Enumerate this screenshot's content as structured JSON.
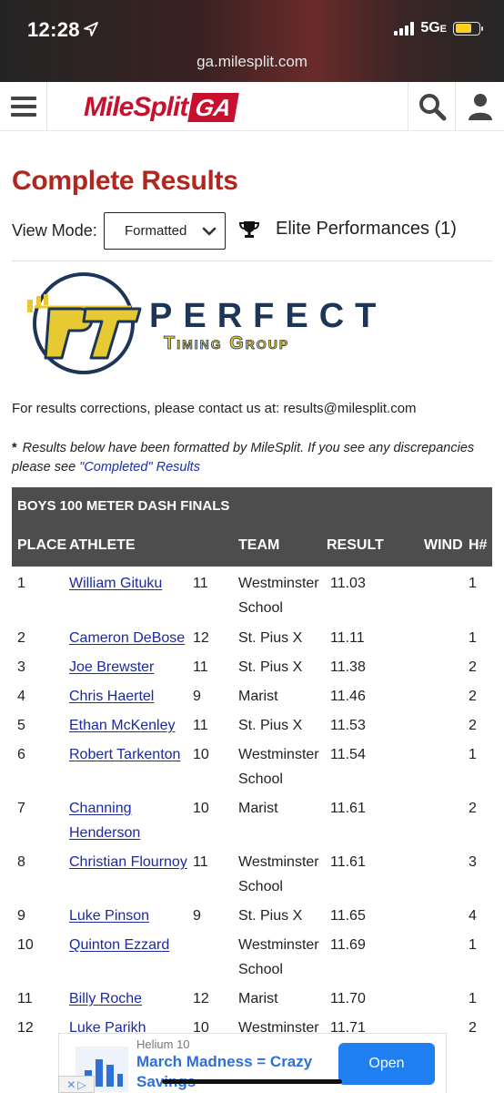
{
  "status_bar": {
    "time": "12:28",
    "network": "5G",
    "network_sup": "E"
  },
  "browser": {
    "url": "ga.milesplit.com"
  },
  "site": {
    "logo_text": "MileSplit",
    "logo_region": "GA"
  },
  "page": {
    "title": "Complete Results",
    "view_mode_label": "View Mode:",
    "view_mode_value": "Formatted",
    "elite_performances": "Elite Performances (1)"
  },
  "timer_logo": {
    "mark": "PT",
    "line1": "PERFECT",
    "line2": "Timing Group"
  },
  "contact_text": "For results corrections, please contact us at: results@milesplit.com",
  "note": {
    "star": "*",
    "text": "Results below have been formatted by MileSplit. If you see any discrepancies please see",
    "link": "\"Completed\" Results"
  },
  "results": {
    "event_title": "BOYS 100 METER DASH FINALS",
    "headers": {
      "place": "PLACE",
      "athlete": "ATHLETE",
      "team": "TEAM",
      "result": "RESULT",
      "wind": "WIND",
      "heat": "H#"
    },
    "rows": [
      {
        "place": "1",
        "athlete": "William Gituku",
        "grade": "11",
        "team": "Westminster School",
        "result": "11.03",
        "heat": "1"
      },
      {
        "place": "2",
        "athlete": "Cameron DeBose",
        "grade": "12",
        "team": "St. Pius X",
        "result": "11.11",
        "heat": "1"
      },
      {
        "place": "3",
        "athlete": "Joe Brewster",
        "grade": "11",
        "team": "St. Pius X",
        "result": "11.38",
        "heat": "2"
      },
      {
        "place": "4",
        "athlete": "Chris Haertel",
        "grade": "9",
        "team": "Marist",
        "result": "11.46",
        "heat": "2"
      },
      {
        "place": "5",
        "athlete": "Ethan McKenley",
        "grade": "11",
        "team": "St. Pius X",
        "result": "11.53",
        "heat": "2"
      },
      {
        "place": "6",
        "athlete": "Robert Tarkenton",
        "grade": "10",
        "team": "Westminster School",
        "result": "11.54",
        "heat": "1"
      },
      {
        "place": "7",
        "athlete": "Channing Henderson",
        "grade": "10",
        "team": "Marist",
        "result": "11.61",
        "heat": "2"
      },
      {
        "place": "8",
        "athlete": "Christian Flournoy",
        "grade": "11",
        "team": "Westminster School",
        "result": "11.61",
        "heat": "3"
      },
      {
        "place": "9",
        "athlete": "Luke Pinson",
        "grade": "9",
        "team": "St. Pius X",
        "result": "11.65",
        "heat": "4"
      },
      {
        "place": "10",
        "athlete": "Quinton Ezzard",
        "grade": "",
        "team": "Westminster School",
        "result": "11.69",
        "heat": "1"
      },
      {
        "place": "11",
        "athlete": "Billy Roche",
        "grade": "12",
        "team": "Marist",
        "result": "11.70",
        "heat": "1"
      },
      {
        "place": "12",
        "athlete": "Luke Parikh",
        "grade": "10",
        "team": "Westminster",
        "result": "11.71",
        "heat": "2"
      }
    ]
  },
  "ad": {
    "brand": "Helium 10",
    "headline": "March Madness = Crazy Savings",
    "cta": "Open"
  },
  "icons": {
    "menu": "hamburger-icon",
    "search": "search-icon",
    "user": "user-icon",
    "trophy": "trophy-icon",
    "chevron": "chevron-down-icon",
    "location": "location-arrow-icon"
  },
  "colors": {
    "brand_red": "#c8102e",
    "title_red": "#b3261e",
    "link_blue": "#1b2aa0",
    "table_header": "#4d4d4d",
    "ad_button": "#1f7ef0"
  }
}
